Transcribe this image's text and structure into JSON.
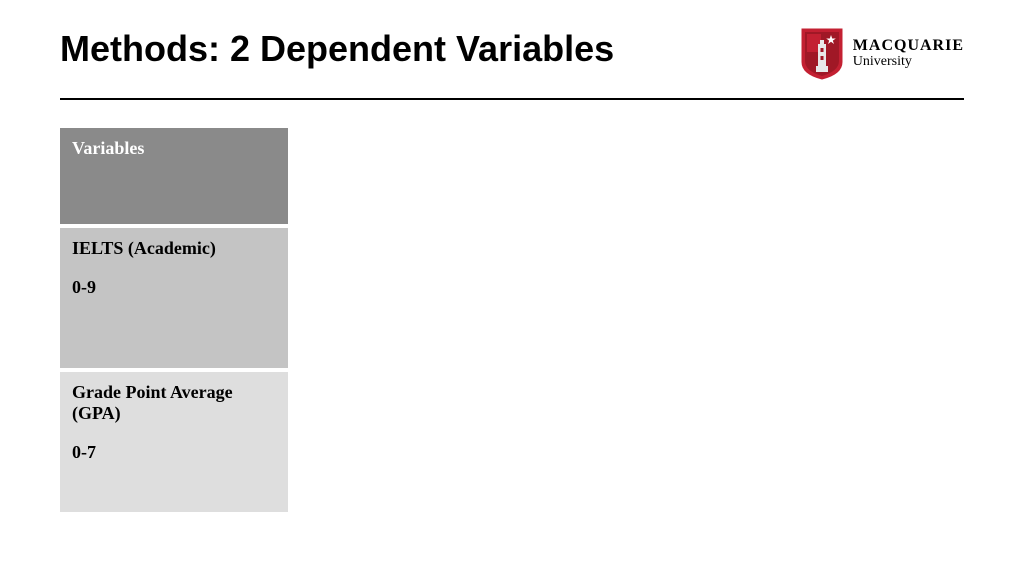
{
  "title": "Methods: 2 Dependent Variables",
  "logo": {
    "name": "MACQUARIE",
    "sub": "University"
  },
  "table": {
    "header": "Variables",
    "rows": [
      {
        "label": "IELTS (Academic)",
        "range": "0-9"
      },
      {
        "label": "Grade Point Average (GPA)",
        "range": "0-7"
      }
    ]
  }
}
